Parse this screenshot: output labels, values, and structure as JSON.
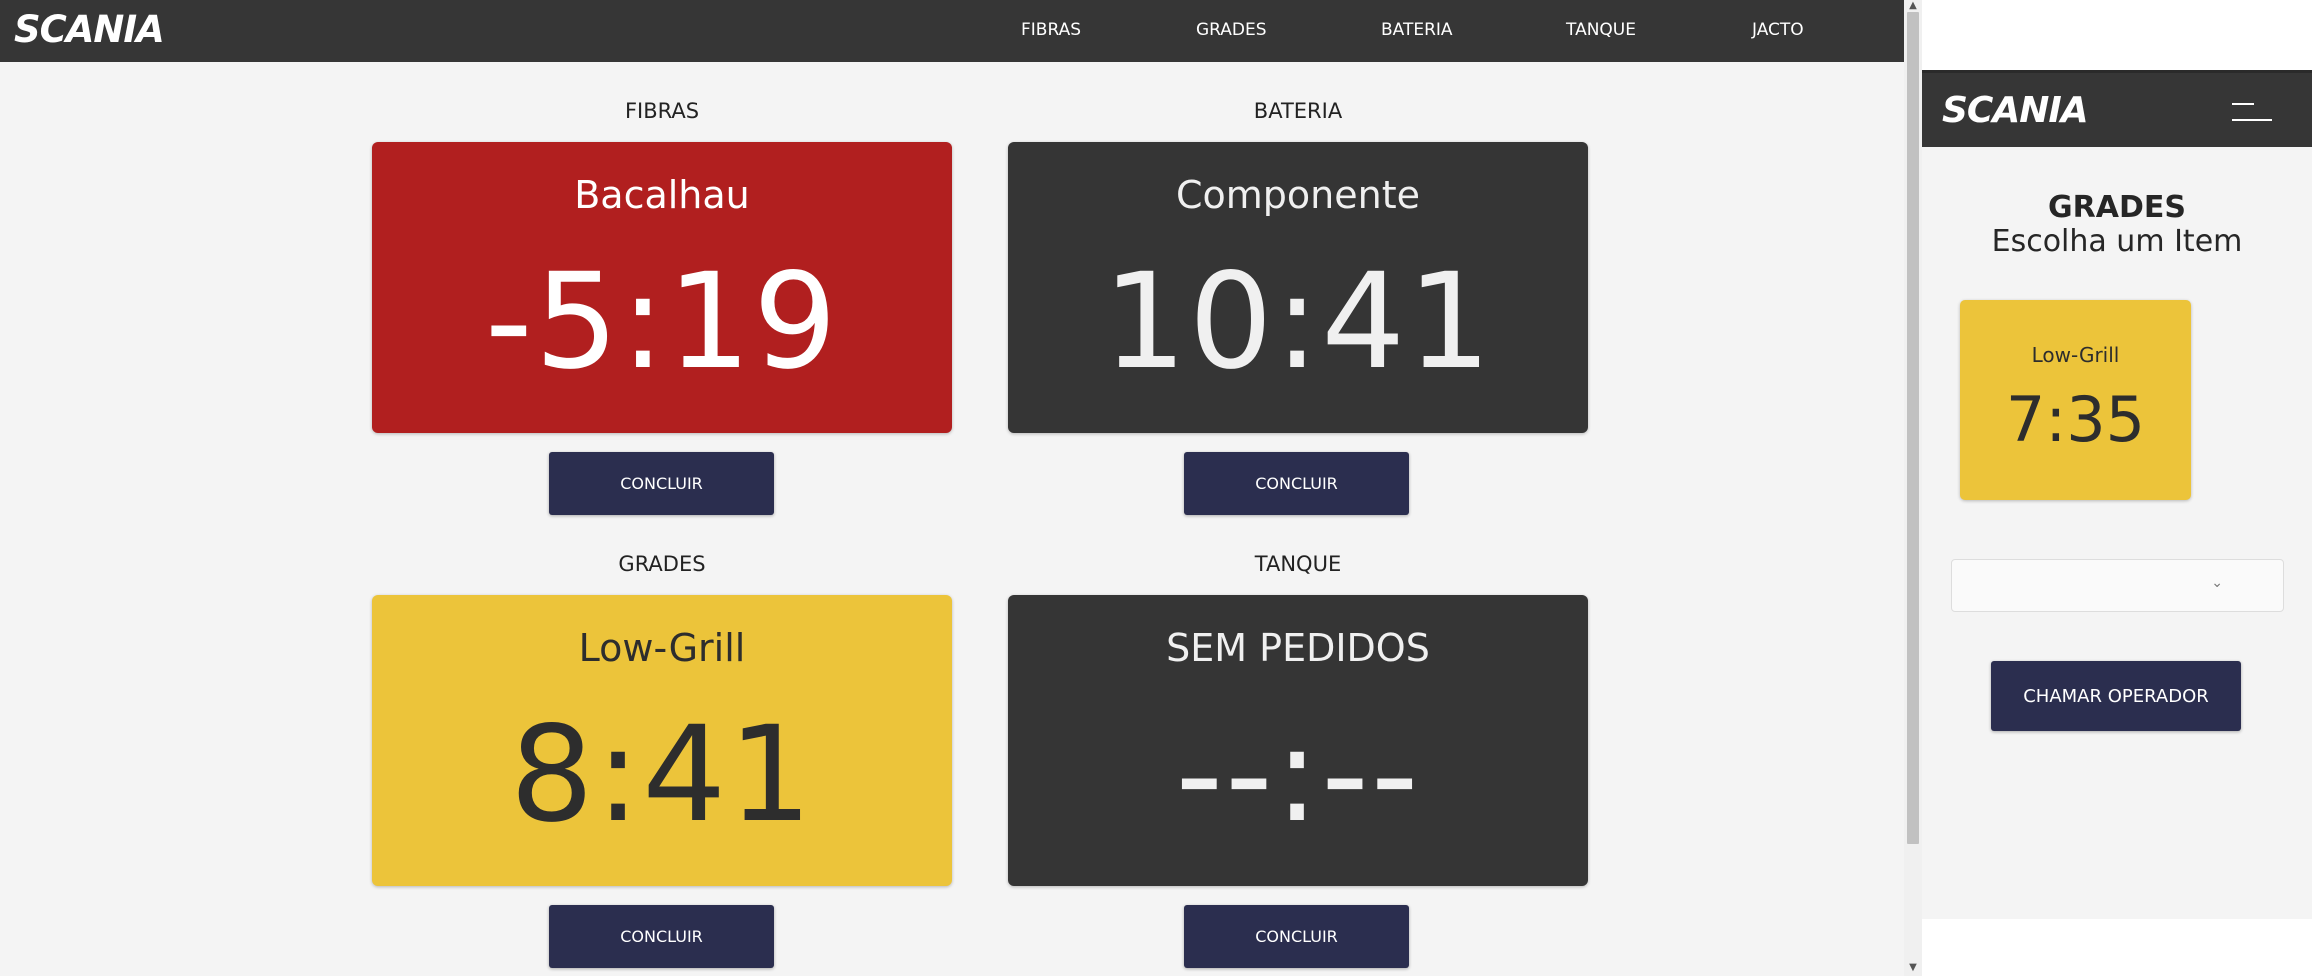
{
  "brand": "SCANIA",
  "nav": {
    "items": [
      "FIBRAS",
      "GRADES",
      "BATERIA",
      "TANQUE",
      "JACTO"
    ]
  },
  "stations": [
    {
      "title": "FIBRAS",
      "item": "Bacalhau",
      "timer": "-5:19",
      "status_color": "#b11f1f",
      "button": "CONCLUIR"
    },
    {
      "title": "BATERIA",
      "item": "Componente",
      "timer": "10:41",
      "status_color": "#353535",
      "button": "CONCLUIR"
    },
    {
      "title": "GRADES",
      "item": "Low-Grill",
      "timer": "8:41",
      "status_color": "#ecc43a",
      "button": "CONCLUIR"
    },
    {
      "title": "TANQUE",
      "item": "SEM PEDIDOS",
      "timer": "--:--",
      "status_color": "#353535",
      "button": "CONCLUIR"
    }
  ],
  "side": {
    "brand": "SCANIA",
    "title": "GRADES",
    "subtitle": "Escolha um Item",
    "card": {
      "item": "Low-Grill",
      "timer": "7:35",
      "color": "#ecc43a"
    },
    "select": {
      "value": ""
    },
    "call_button": "CHAMAR OPERADOR"
  },
  "colors": {
    "header": "#363636",
    "button": "#2b2e4f",
    "background": "#f4f4f4"
  }
}
